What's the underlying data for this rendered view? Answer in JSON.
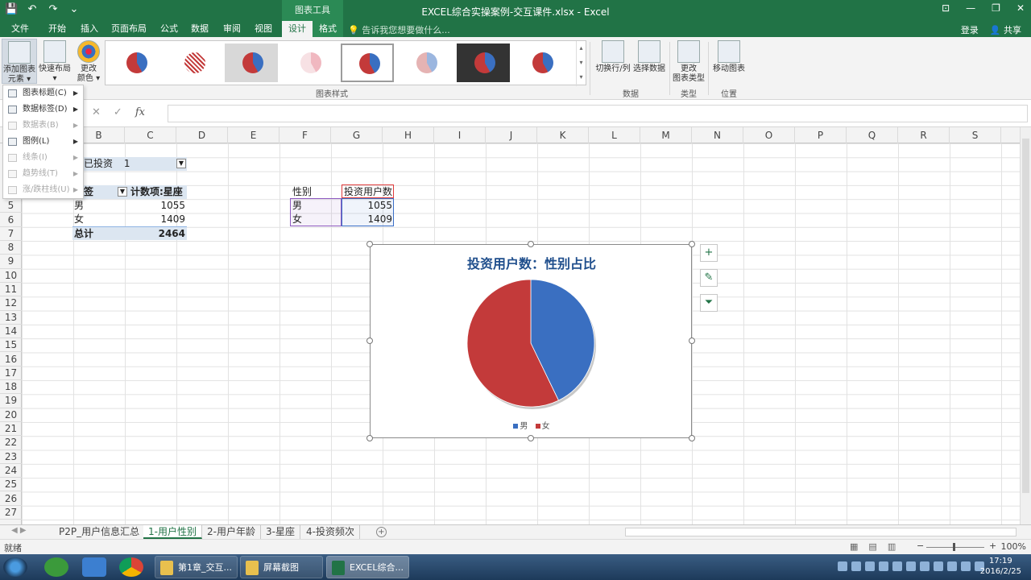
{
  "window": {
    "title": "EXCEL综合实操案例-交互课件.xlsx - Excel",
    "context_tools_label": "图表工具",
    "quick_access": [
      "💾",
      "↶",
      "↷",
      "⌄"
    ],
    "controls": [
      "⊡",
      "—",
      "❐",
      "✕"
    ]
  },
  "ribbon_tabs": [
    "文件",
    "开始",
    "插入",
    "页面布局",
    "公式",
    "数据",
    "审阅",
    "视图",
    "设计",
    "格式"
  ],
  "active_tab": "设计",
  "tell_me": "告诉我您想要做什么...",
  "account": {
    "login": "登录",
    "share": "共享"
  },
  "ribbon": {
    "add_element": "添加图表元素",
    "add_element_line1": "添加图表",
    "add_element_line2": "元素 ▾",
    "quick_layout_line1": "快速布局",
    "quick_layout_line2": "▾",
    "change_colors_line1": "更改",
    "change_colors_line2": "颜色 ▾",
    "styles_group": "图表样式",
    "switch_row_col": "切换行/列",
    "select_data": "选择数据",
    "data_group": "数据",
    "change_type_line1": "更改",
    "change_type_line2": "图表类型",
    "type_group": "类型",
    "move_chart": "移动图表",
    "location_group": "位置",
    "gallery_scroll": [
      "▴",
      "▾",
      "▾"
    ]
  },
  "dropdown_menu": [
    {
      "label": "图表标题(C)",
      "enabled": true
    },
    {
      "label": "数据标签(D)",
      "enabled": true
    },
    {
      "label": "数据表(B)",
      "enabled": false
    },
    {
      "label": "图例(L)",
      "enabled": true
    },
    {
      "label": "线条(I)",
      "enabled": false
    },
    {
      "label": "趋势线(T)",
      "enabled": false
    },
    {
      "label": "涨/跌柱线(U)",
      "enabled": false
    }
  ],
  "formula_bar": {
    "cancel": "✕",
    "enter": "✓",
    "fx": "fx",
    "value": ""
  },
  "columns": [
    "B",
    "C",
    "D",
    "E",
    "F",
    "G",
    "H",
    "I",
    "J",
    "K",
    "L",
    "M",
    "N",
    "O",
    "P",
    "Q",
    "R",
    "S"
  ],
  "rows": [
    "5",
    "6",
    "7",
    "8",
    "9",
    "10",
    "11",
    "12",
    "13",
    "14",
    "15",
    "16",
    "17",
    "18",
    "19",
    "20",
    "21",
    "22",
    "23",
    "24",
    "25",
    "26",
    "27"
  ],
  "pivot": {
    "filter_label": "否已投资",
    "filter_value": "1",
    "row_label_header": "标签",
    "value_header": "计数项:星座",
    "rows": [
      {
        "label": "男",
        "value": "1055"
      },
      {
        "label": "女",
        "value": "1409"
      }
    ],
    "total_label": "总计",
    "total_value": "2464"
  },
  "source_table": {
    "header_gender": "性别",
    "header_count": "投资用户数",
    "rows": [
      {
        "label": "男",
        "value": "1055"
      },
      {
        "label": "女",
        "value": "1409"
      }
    ]
  },
  "chart_buttons": [
    "+",
    "✎",
    "⏷"
  ],
  "chart_data": {
    "type": "pie",
    "title": "投资用户数：性别占比",
    "categories": [
      "男",
      "女"
    ],
    "values": [
      1055,
      1409
    ],
    "colors": [
      "#3a6fc1",
      "#c33a3a"
    ],
    "legend": "bottom"
  },
  "sheet_tabs": [
    "P2P_用户信息汇总",
    "1-用户性别",
    "2-用户年龄",
    "3-星座",
    "4-投资频次"
  ],
  "active_sheet": "1-用户性别",
  "add_sheet": "+",
  "status": {
    "ready": "就绪",
    "zoom": "100%",
    "zoom_out": "−",
    "zoom_in": "+",
    "views": [
      "▦",
      "▤",
      "▥"
    ]
  },
  "taskbar": {
    "items": [
      "第1章_交互...",
      "屏幕截图",
      "EXCEL综合..."
    ],
    "time": "17:19",
    "date": "2016/2/25"
  }
}
